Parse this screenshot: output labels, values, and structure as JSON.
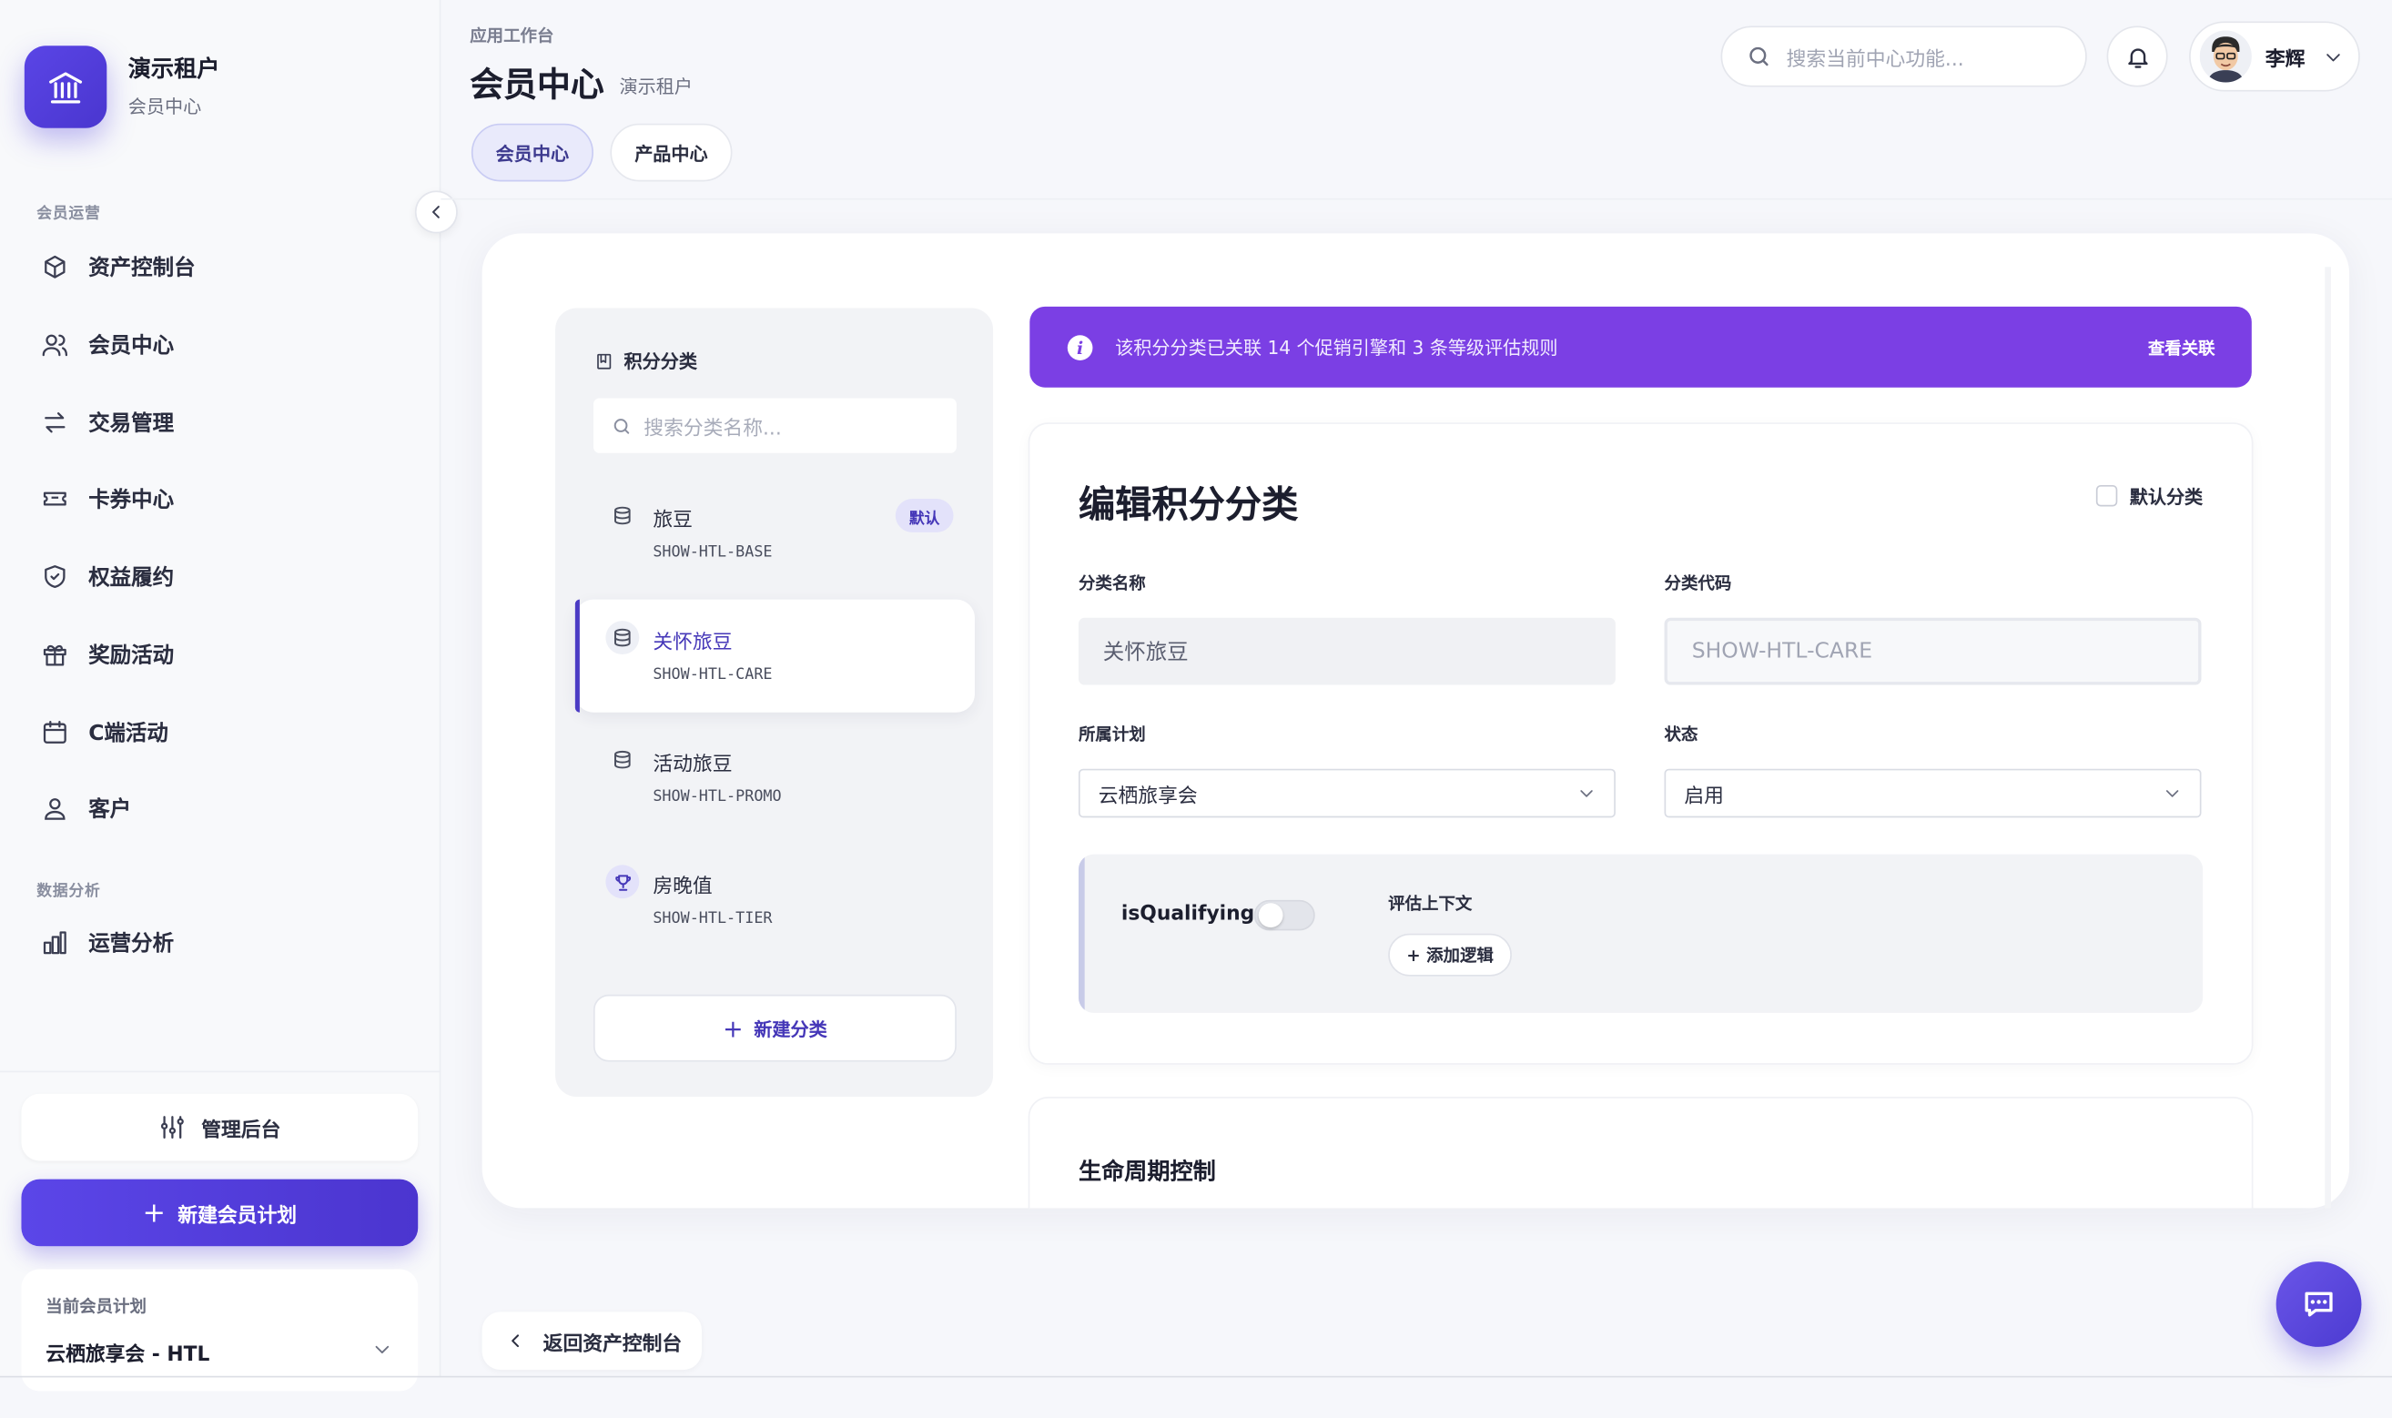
{
  "brand": {
    "title": "演示租户",
    "subtitle": "会员中心"
  },
  "sidebar": {
    "section_ops": "会员运营",
    "items": [
      {
        "label": "资产控制台",
        "icon": "cube-icon"
      },
      {
        "label": "会员中心",
        "icon": "users-icon"
      },
      {
        "label": "交易管理",
        "icon": "transfer-icon"
      },
      {
        "label": "卡券中心",
        "icon": "ticket-icon"
      },
      {
        "label": "权益履约",
        "icon": "shield-check-icon"
      },
      {
        "label": "奖励活动",
        "icon": "gift-icon"
      },
      {
        "label": "C端活动",
        "icon": "calendar-icon"
      },
      {
        "label": "客户",
        "icon": "user-icon"
      }
    ],
    "section_analytics": "数据分析",
    "analytics_items": [
      {
        "label": "运营分析",
        "icon": "bar-chart-icon"
      }
    ],
    "admin_label": "管理后台",
    "new_plan_label": "新建会员计划",
    "current_plan_label": "当前会员计划",
    "current_plan_value": "云栖旅享会 - HTL"
  },
  "header": {
    "breadcrumb": "应用工作台",
    "title": "会员中心",
    "tenant": "演示租户",
    "tabs": [
      {
        "label": "会员中心"
      },
      {
        "label": "产品中心"
      }
    ],
    "search_placeholder": "搜索当前中心功能...",
    "user_name": "李辉"
  },
  "categories": {
    "title": "积分分类",
    "search_placeholder": "搜索分类名称...",
    "items": [
      {
        "name": "旅豆",
        "code": "SHOW-HTL-BASE",
        "badge": "默认",
        "icon": "database-icon"
      },
      {
        "name": "关怀旅豆",
        "code": "SHOW-HTL-CARE",
        "icon": "database-icon"
      },
      {
        "name": "活动旅豆",
        "code": "SHOW-HTL-PROMO",
        "icon": "database-icon"
      },
      {
        "name": "房晚值",
        "code": "SHOW-HTL-TIER",
        "icon": "trophy-icon"
      }
    ],
    "add_label": "新建分类"
  },
  "alert": {
    "text": "该积分分类已关联 14 个促销引擎和 3 条等级评估规则",
    "link": "查看关联"
  },
  "form": {
    "title": "编辑积分分类",
    "default_label": "默认分类",
    "name_label": "分类名称",
    "name_value": "关怀旅豆",
    "code_label": "分类代码",
    "code_value": "SHOW-HTL-CARE",
    "plan_label": "所属计划",
    "plan_value": "云栖旅享会",
    "status_label": "状态",
    "status_value": "启用",
    "qualifying_label": "isQualifying",
    "context_label": "评估上下文",
    "add_logic_label": "+ 添加逻辑"
  },
  "lifecycle": {
    "title": "生命周期控制"
  },
  "back_label": "返回资产控制台",
  "colors": {
    "accent": "#5a45e6",
    "alert": "#7b3fe4",
    "active_text": "#4537b8"
  }
}
